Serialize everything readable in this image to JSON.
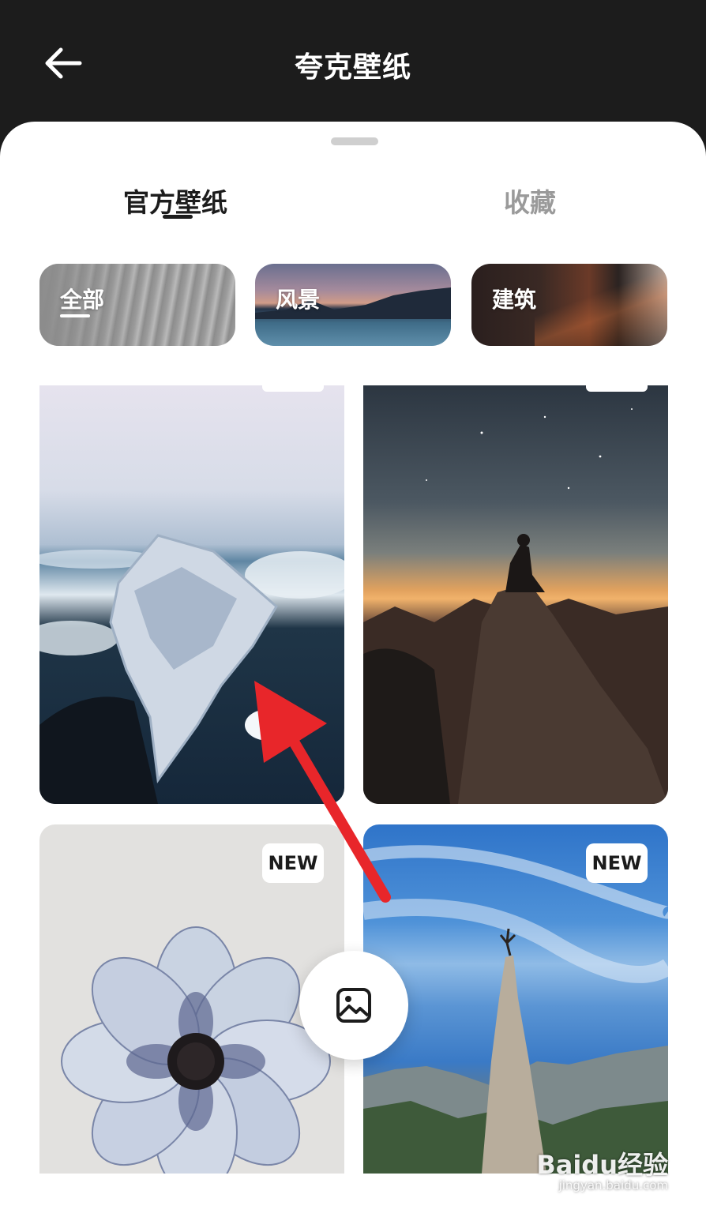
{
  "header": {
    "title": "夸克壁纸",
    "back_icon": "arrow-left-icon"
  },
  "tabs": [
    {
      "label": "官方壁纸",
      "active": true
    },
    {
      "label": "收藏",
      "active": false
    }
  ],
  "categories": [
    {
      "label": "全部",
      "active": true
    },
    {
      "label": "风景",
      "active": false
    },
    {
      "label": "建筑",
      "active": false
    }
  ],
  "wallpapers": [
    {
      "subject": "ice-chunk",
      "badge": ""
    },
    {
      "subject": "sunset-mountain",
      "badge": ""
    },
    {
      "subject": "flower",
      "badge": "NEW"
    },
    {
      "subject": "climber-peak",
      "badge": "NEW"
    }
  ],
  "fab": {
    "icon": "image-icon"
  },
  "annotation": {
    "arrow_color": "#e8262a"
  },
  "watermark": {
    "brand": "Baidu经验",
    "url": "jingyan.baidu.com"
  },
  "colors": {
    "topbar": "#1c1c1c",
    "sheet": "#ffffff",
    "active_tab": "#1c1c1c",
    "inactive_tab": "#9a9a9a"
  }
}
